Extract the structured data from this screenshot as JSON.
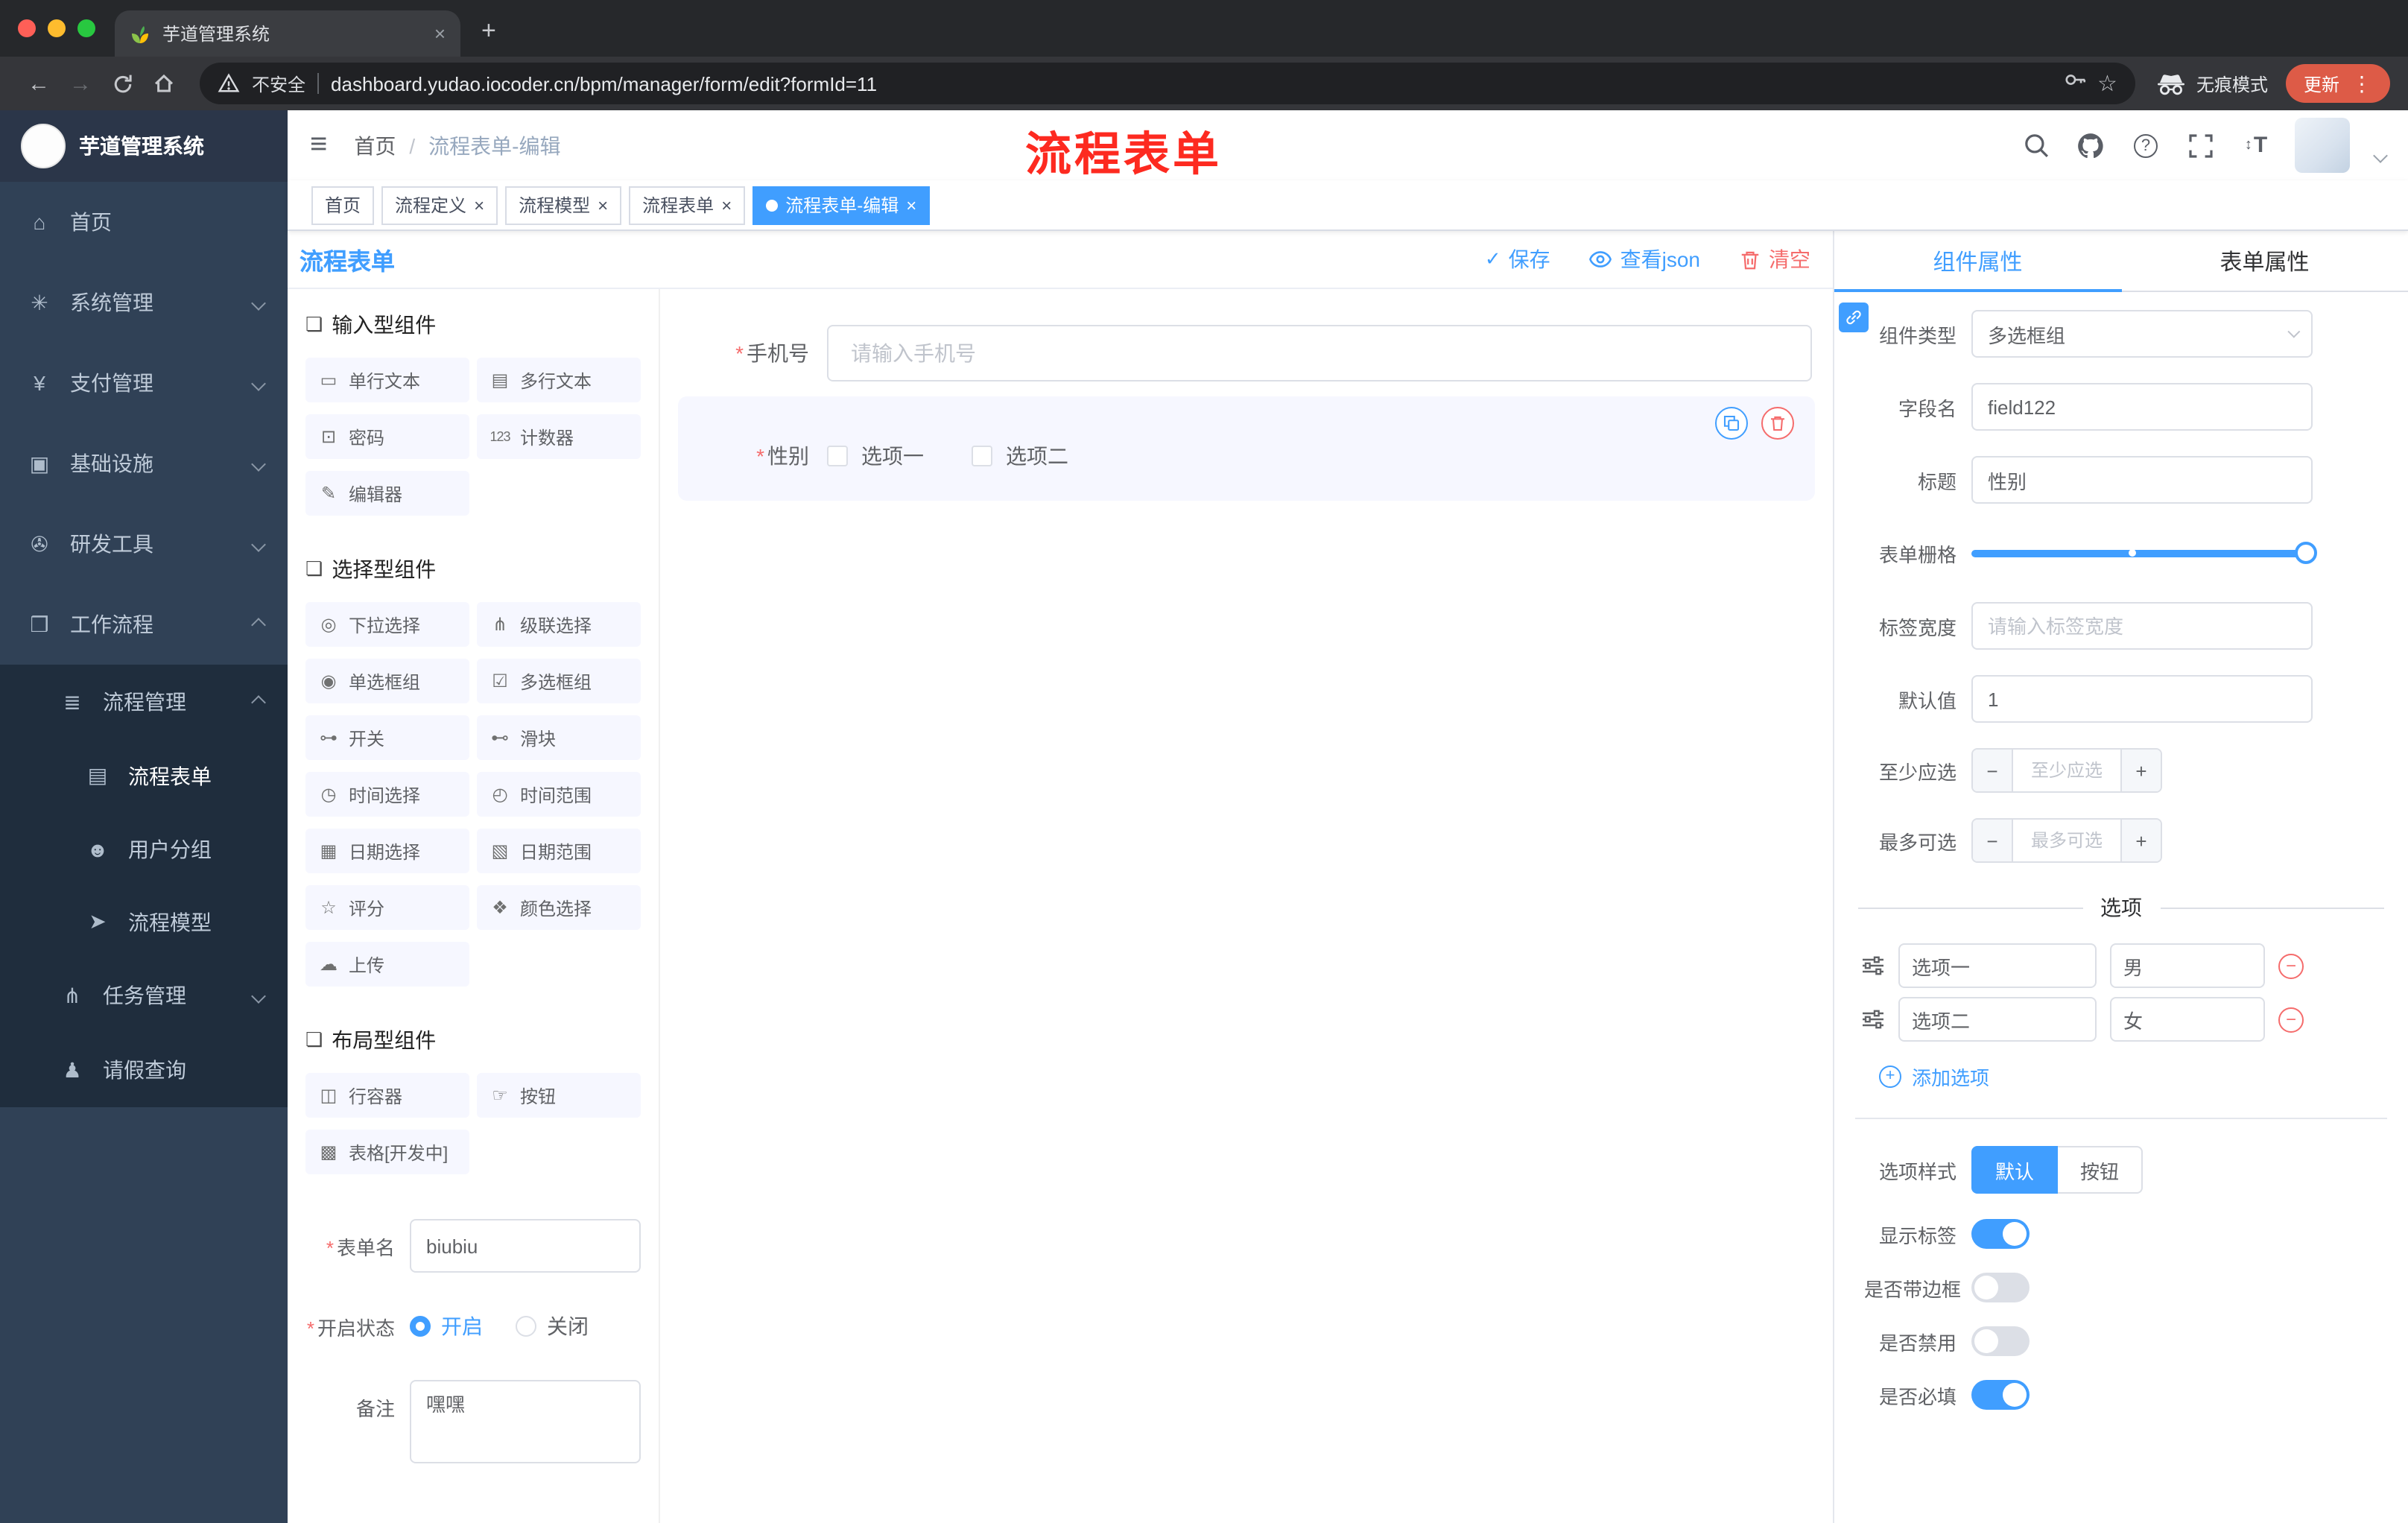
{
  "colors": {
    "accent": "#409eff",
    "danger": "#f56c6c",
    "sidebar_bg": "#304156",
    "selected_bg": "#f6f7ff"
  },
  "glyphs": {
    "close": "×",
    "new_tab": "+",
    "back": "←",
    "forward": "→",
    "menu_dots": "⋮",
    "hamburger": "≡",
    "star": "☆",
    "question": "?",
    "font_size": "T",
    "updown": "↕",
    "check": "✓",
    "minus": "−",
    "plus": "+",
    "group_icon": "❏",
    "breadcrumb_sep": "/"
  },
  "browser": {
    "tab_title": "芋道管理系统",
    "security": "不安全",
    "url": "dashboard.yudao.iocoder.cn/bpm/manager/form/edit?formId=11",
    "incognito": "无痕模式",
    "update": "更新"
  },
  "annotation": {
    "text": "流程表单"
  },
  "sidebar": {
    "logo": "芋道管理系统",
    "items": [
      {
        "glyph": "⌂",
        "label": "首页"
      },
      {
        "glyph": "✳",
        "label": "系统管理"
      },
      {
        "glyph": "¥",
        "label": "支付管理"
      },
      {
        "glyph": "▣",
        "label": "基础设施"
      },
      {
        "glyph": "✇",
        "label": "研发工具"
      },
      {
        "glyph": "❒",
        "label": "工作流程"
      },
      {
        "glyph": "≣",
        "label": "流程管理"
      },
      {
        "glyph": "▤",
        "label": "流程表单"
      },
      {
        "glyph": "☻",
        "label": "用户分组"
      },
      {
        "glyph": "➤",
        "label": "流程模型"
      },
      {
        "glyph": "⋔",
        "label": "任务管理"
      },
      {
        "glyph": "♟",
        "label": "请假查询"
      }
    ]
  },
  "header": {
    "breadcrumb_home": "首页",
    "breadcrumb_current": "流程表单-编辑"
  },
  "tags": [
    {
      "label": "首页"
    },
    {
      "label": "流程定义"
    },
    {
      "label": "流程模型"
    },
    {
      "label": "流程表单"
    },
    {
      "label": "流程表单-编辑"
    }
  ],
  "palette": {
    "title": "流程表单",
    "groups": [
      {
        "title": "输入型组件",
        "items": [
          {
            "glyph": "▭",
            "label": "单行文本"
          },
          {
            "glyph": "▤",
            "label": "多行文本"
          },
          {
            "glyph": "⊡",
            "label": "密码"
          },
          {
            "glyph": "123",
            "label": "计数器"
          },
          {
            "glyph": "✎",
            "label": "编辑器"
          }
        ]
      },
      {
        "title": "选择型组件",
        "items": [
          {
            "glyph": "◎",
            "label": "下拉选择"
          },
          {
            "glyph": "⋔",
            "label": "级联选择"
          },
          {
            "glyph": "◉",
            "label": "单选框组"
          },
          {
            "glyph": "☑",
            "label": "多选框组"
          },
          {
            "glyph": "⊶",
            "label": "开关"
          },
          {
            "glyph": "⊷",
            "label": "滑块"
          },
          {
            "glyph": "◷",
            "label": "时间选择"
          },
          {
            "glyph": "◴",
            "label": "时间范围"
          },
          {
            "glyph": "▦",
            "label": "日期选择"
          },
          {
            "glyph": "▧",
            "label": "日期范围"
          },
          {
            "glyph": "☆",
            "label": "评分"
          },
          {
            "glyph": "❖",
            "label": "颜色选择"
          },
          {
            "glyph": "☁",
            "label": "上传"
          }
        ]
      },
      {
        "title": "布局型组件",
        "items": [
          {
            "glyph": "◫",
            "label": "行容器"
          },
          {
            "glyph": "☞",
            "label": "按钮"
          },
          {
            "glyph": "▩",
            "label": "表格[开发中]"
          }
        ]
      }
    ],
    "settings": {
      "name_label": "表单名",
      "name_value": "biubiu",
      "status_label": "开启状态",
      "status_on": "开启",
      "status_off": "关闭",
      "remark_label": "备注",
      "remark_value": "嘿嘿"
    }
  },
  "canvas": {
    "actions": {
      "save": "保存",
      "view_json": "查看json",
      "clear": "清空"
    },
    "phone": {
      "label": "手机号",
      "placeholder": "请输入手机号"
    },
    "gender": {
      "label": "性别",
      "option1": "选项一",
      "option2": "选项二"
    }
  },
  "inspector": {
    "tabs": {
      "component": "组件属性",
      "form": "表单属性"
    },
    "type": {
      "label": "组件类型",
      "value": "多选框组"
    },
    "field": {
      "label": "字段名",
      "value": "field122"
    },
    "title": {
      "label": "标题",
      "value": "性别"
    },
    "grid": {
      "label": "表单栅格"
    },
    "label_width": {
      "label": "标签宽度",
      "placeholder": "请输入标签宽度"
    },
    "default": {
      "label": "默认值",
      "value": "1"
    },
    "min": {
      "label": "至少应选",
      "placeholder": "至少应选"
    },
    "max": {
      "label": "最多可选",
      "placeholder": "最多可选"
    },
    "options_title": "选项",
    "options": [
      {
        "name": "选项一",
        "value": "男"
      },
      {
        "name": "选项二",
        "value": "女"
      }
    ],
    "add_option": "添加选项",
    "style": {
      "label": "选项样式",
      "default": "默认",
      "button": "按钮"
    },
    "switches": {
      "show_label": "显示标签",
      "border": "是否带边框",
      "disabled": "是否禁用",
      "required": "是否必填"
    }
  }
}
